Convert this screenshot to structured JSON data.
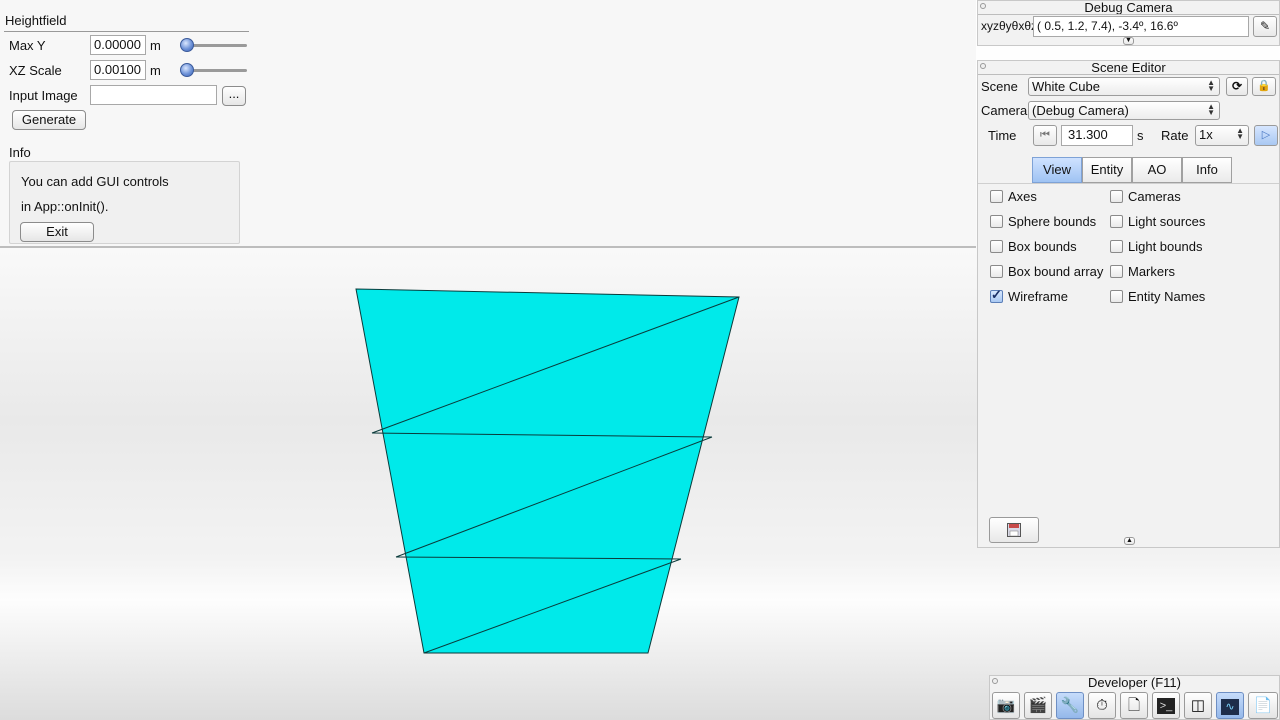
{
  "heightfield": {
    "title": "Heightfield",
    "max_y": {
      "label": "Max Y",
      "value": "0.00000",
      "unit": "m",
      "slider_fraction": 0.0
    },
    "xz_scale": {
      "label": "XZ Scale",
      "value": "0.00100",
      "unit": "m",
      "slider_fraction": 0.0
    },
    "input_image": {
      "label": "Input Image",
      "value": "",
      "browse_label": "..."
    },
    "generate_label": "Generate",
    "info": {
      "title": "Info",
      "line1": "You can add GUI controls",
      "line2": "in App::onInit().",
      "exit_label": "Exit"
    }
  },
  "debug_camera": {
    "title": "Debug Camera",
    "axis_label": "xyzθyθxθz",
    "value": "(  0.5,   1.2,   7.4),  -3.4º,  16.6º",
    "expand_icon": "down-triangle-icon",
    "edit_icon": "pencil-icon"
  },
  "scene_editor": {
    "title": "Scene Editor",
    "scene_label": "Scene",
    "scene_value": "White Cube",
    "camera_label": "Camera",
    "camera_value": "(Debug Camera)",
    "time_label": "Time",
    "time_value": "31.300",
    "time_unit": "s",
    "rate_label": "Rate",
    "rate_value": "1x",
    "tabs": [
      {
        "label": "View",
        "active": true
      },
      {
        "label": "Entity",
        "active": false
      },
      {
        "label": "AO",
        "active": false
      },
      {
        "label": "Info",
        "active": false
      }
    ],
    "checkboxes_left": [
      {
        "label": "Axes",
        "checked": false
      },
      {
        "label": "Sphere bounds",
        "checked": false
      },
      {
        "label": "Box bounds",
        "checked": false
      },
      {
        "label": "Box bound array",
        "checked": false
      },
      {
        "label": "Wireframe",
        "checked": true
      }
    ],
    "checkboxes_right": [
      {
        "label": "Cameras",
        "checked": false
      },
      {
        "label": "Light sources",
        "checked": false
      },
      {
        "label": "Light bounds",
        "checked": false
      },
      {
        "label": "Markers",
        "checked": false
      },
      {
        "label": "Entity Names",
        "checked": false
      }
    ]
  },
  "developer": {
    "title": "Developer (F11)",
    "icons": [
      "camera-icon",
      "film-clapper-icon",
      "tools-icon",
      "clock-icon",
      "new-file-icon",
      "terminal-icon",
      "window-layout-icon",
      "profiler-graph-icon",
      "document-icon"
    ]
  },
  "colors": {
    "mesh": "#00eaea",
    "accent": "#9fc3f3"
  }
}
